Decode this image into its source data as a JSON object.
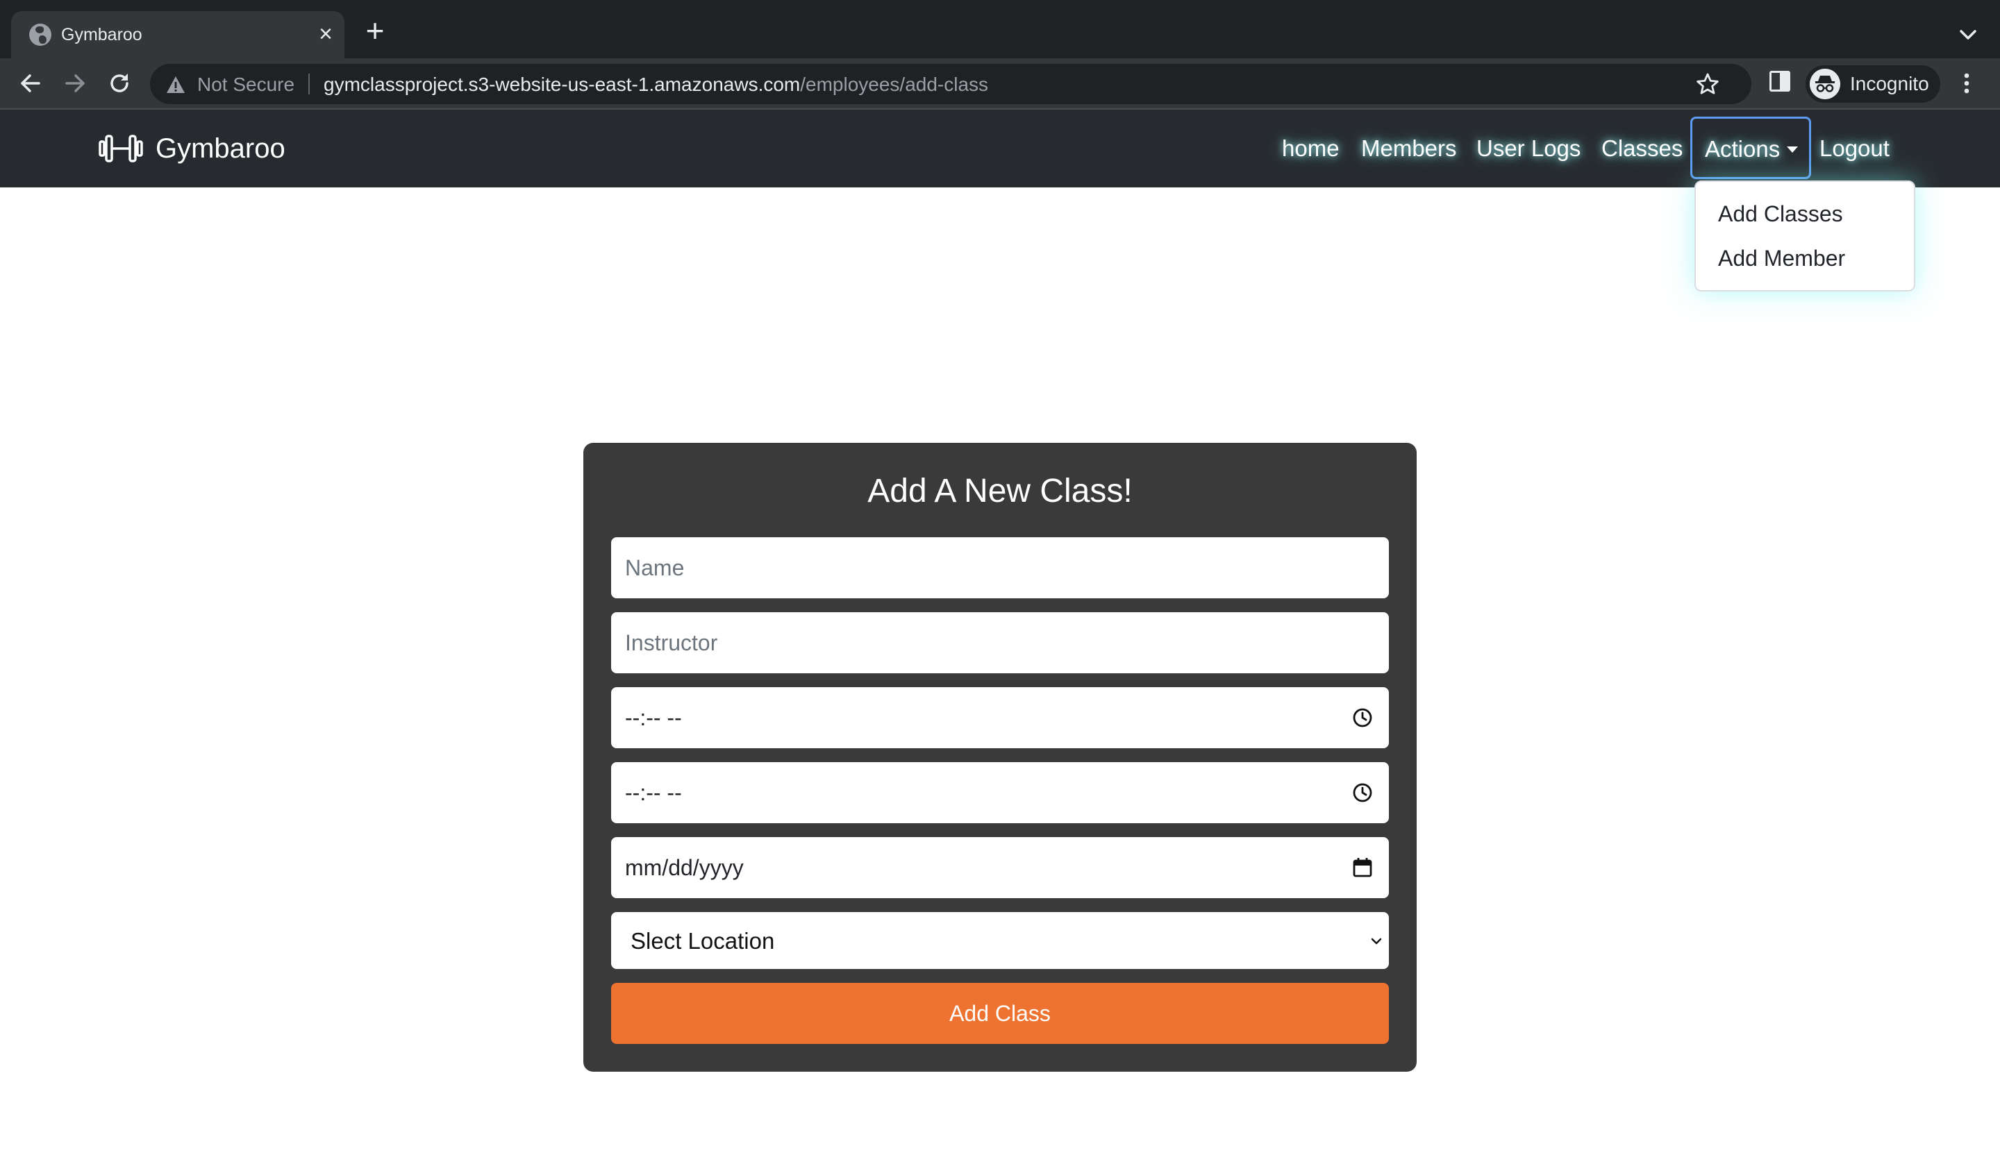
{
  "browser": {
    "tab_title": "Gymbaroo",
    "security_label": "Not Secure",
    "url_host": "gymclassproject.s3-website-us-east-1.amazonaws.com",
    "url_path": "/employees/add-class",
    "profile_label": "Incognito",
    "icons": [
      "globe-icon",
      "close-icon",
      "plus-icon",
      "chevron-down-icon",
      "back-arrow-icon",
      "forward-arrow-icon",
      "reload-icon",
      "warning-icon",
      "star-icon",
      "side-panel-icon",
      "incognito-icon",
      "kebab-menu-icon"
    ]
  },
  "navbar": {
    "brand": "Gymbaroo",
    "brand_icon": "dumbbell-icon",
    "links": {
      "home": "home",
      "members": "Members",
      "user_logs": "User Logs",
      "classes": "Classes",
      "actions": "Actions",
      "logout": "Logout"
    },
    "dropdown": {
      "add_classes": "Add Classes",
      "add_member": "Add Member"
    }
  },
  "form": {
    "title": "Add A New Class!",
    "name_placeholder": "Name",
    "instructor_placeholder": "Instructor",
    "start_time": "--:-- --",
    "end_time": "--:-- --",
    "date": "mm/dd/yyyy",
    "location_selected": "Slect Location",
    "submit_label": "Add Class"
  },
  "colors": {
    "navbar_bg": "#272b2f",
    "card_bg": "#3a3a3a",
    "submit_bg": "#ee7330",
    "active_outline": "#5c9cf2",
    "nav_glow": "#aaffff"
  }
}
